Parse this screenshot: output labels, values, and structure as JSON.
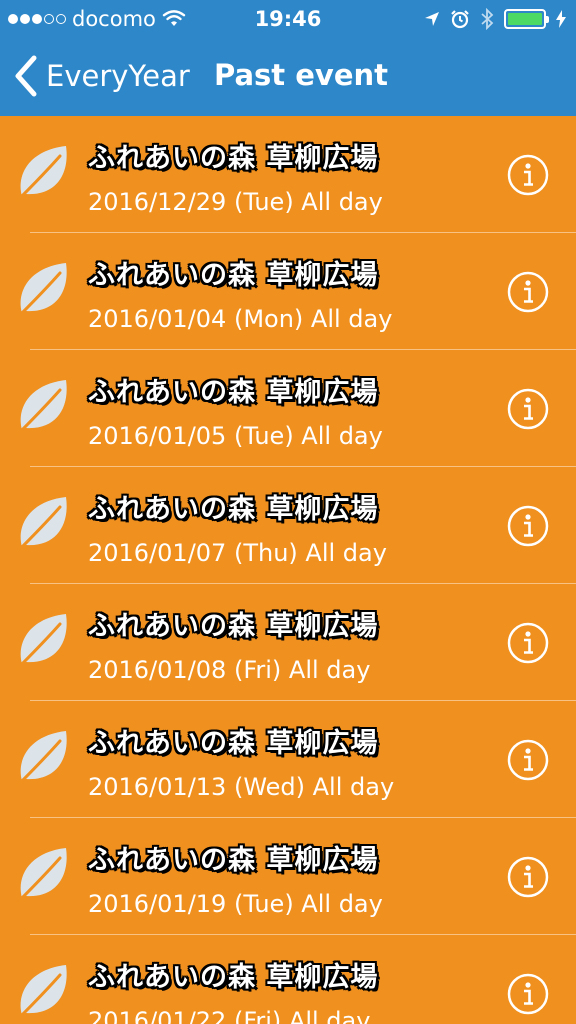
{
  "status_bar": {
    "carrier": "docomo",
    "time": "19:46",
    "signal_strength": 3,
    "signal_max": 5,
    "battery_color": "#4CD964"
  },
  "nav": {
    "back_label": "EveryYear",
    "title": "Past event",
    "bar_color": "#2D87C9"
  },
  "list": {
    "row_color": "#F0901E",
    "rows": [
      {
        "title": "ふれあいの森 草柳広場",
        "date": "2016/12/29 (Tue) All day"
      },
      {
        "title": "ふれあいの森 草柳広場",
        "date": "2016/01/04 (Mon) All day"
      },
      {
        "title": "ふれあいの森 草柳広場",
        "date": "2016/01/05 (Tue) All day"
      },
      {
        "title": "ふれあいの森 草柳広場",
        "date": "2016/01/07 (Thu) All day"
      },
      {
        "title": "ふれあいの森 草柳広場",
        "date": "2016/01/08 (Fri) All day"
      },
      {
        "title": "ふれあいの森 草柳広場",
        "date": "2016/01/13 (Wed) All day"
      },
      {
        "title": "ふれあいの森 草柳広場",
        "date": "2016/01/19 (Tue) All day"
      },
      {
        "title": "ふれあいの森 草柳広場",
        "date": "2016/01/22 (Fri) All day"
      }
    ]
  }
}
